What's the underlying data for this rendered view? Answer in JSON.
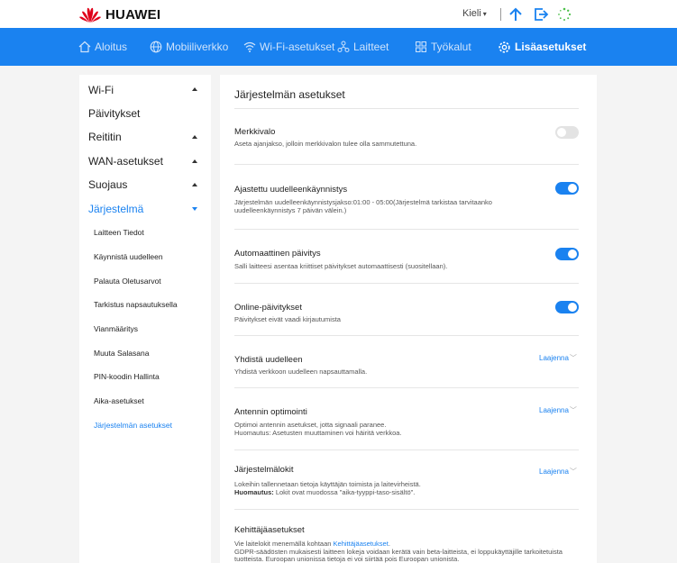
{
  "header": {
    "brand": "HUAWEI",
    "language_label": "Kieli",
    "colors": {
      "brand_red": "#e0001b",
      "accent_blue": "#1a82f0",
      "nav_bg": "#1a82f0"
    }
  },
  "nav": {
    "items": [
      {
        "label": "Aloitus",
        "icon": "home-icon"
      },
      {
        "label": "Mobiiliverkko",
        "icon": "globe-icon"
      },
      {
        "label": "Wi-Fi-asetukset",
        "icon": "wifi-icon"
      },
      {
        "label": "Laitteet",
        "icon": "devices-icon"
      },
      {
        "label": "Työkalut",
        "icon": "tools-icon"
      },
      {
        "label": "Lisäasetukset",
        "icon": "gear-icon",
        "active": true
      }
    ]
  },
  "sidebar": {
    "items": [
      {
        "label": "Wi-Fi"
      },
      {
        "label": "Päivitykset"
      },
      {
        "label": "Reititin"
      },
      {
        "label": "WAN-asetukset"
      },
      {
        "label": "Suojaus"
      },
      {
        "label": "Järjestelmä"
      }
    ],
    "subitems": [
      {
        "label": "Laitteen Tiedot"
      },
      {
        "label": "Käynnistä uudelleen"
      },
      {
        "label": "Palauta Oletusarvot"
      },
      {
        "label": "Tarkistus napsautuksella"
      },
      {
        "label": "Vianmääritys"
      },
      {
        "label": "Muuta Salasana"
      },
      {
        "label": "PIN-koodin Hallinta"
      },
      {
        "label": "Aika-asetukset"
      },
      {
        "label": "Järjestelmän asetukset",
        "active": true
      }
    ]
  },
  "main": {
    "title": "Järjestelmän asetukset",
    "rows": [
      {
        "title": "Merkkivalo",
        "desc": "Aseta ajanjakso, jolloin merkkivalon tulee olla sammutettuna.",
        "toggle": false
      },
      {
        "title": "Ajastettu uudelleenkäynnistys",
        "desc": "Järjestelmän uudelleenkäynnistysjakso:01:00 - 05:00(Järjestelmä tarkistaa tarvitaanko uudelleenkäynnistys 7 päivän välein.)",
        "toggle": true
      },
      {
        "title": "Automaattinen päivitys",
        "desc": "Salli laitteesi asentaa kriittiset päivitykset automaattisesti (suositellaan).",
        "toggle": true
      },
      {
        "title": "Online-päivitykset",
        "desc": "Päivitykset eivät vaadi kirjautumista",
        "toggle": true
      },
      {
        "title": "Yhdistä uudelleen",
        "desc": "Yhdistä verkkoon uudelleen napsauttamalla.",
        "expand_label": "Laajenna"
      },
      {
        "title": "Antennin optimointi",
        "desc": "Optimoi antennin asetukset, jotta signaali paranee.",
        "desc2": "Huomautus: Asetusten muuttaminen voi häiritä verkkoa.",
        "expand_label": "Laajenna"
      },
      {
        "title": "Järjestelmälokit",
        "desc": "Lokeihin tallennetaan tietoja käyttäjän toimista ja laitevirheistä.",
        "desc2_label": "Huomautus:",
        "desc2": " Lokit ovat muodossa \"aika-tyyppi-taso-sisältö\".",
        "expand_label": "Laajenna"
      },
      {
        "title": "Kehittäjäasetukset",
        "desc_prefix": "Vie laitelokit menemällä kohtaan ",
        "desc_link": "Kehittäjäasetukset",
        "desc_suffix": ".",
        "desc2": "GDPR-säädösten mukaisesti laitteen lokeja voidaan kerätä vain beta-laitteista, ei loppukäyttäjille tarkoitetuista tuotteista. Euroopan unionissa tietoja ei voi siirtää pois Euroopan unionista."
      }
    ]
  }
}
